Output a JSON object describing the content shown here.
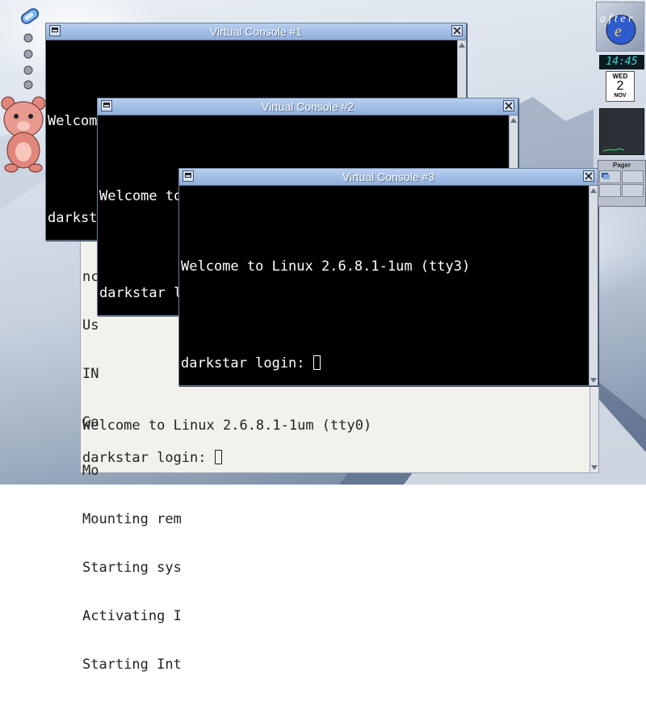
{
  "desktop": {
    "icon": "paperclip-icon",
    "dock_icons": [
      "pin-icon",
      "pin-icon",
      "pin-icon",
      "pin-icon"
    ],
    "mascot": "teddy-bear-icon"
  },
  "dock": {
    "logo": "afterstep-logo",
    "clock_time": "14:45",
    "calendar": {
      "day": "WED",
      "date": "2",
      "month": "NOV"
    },
    "pager_title": "Pager"
  },
  "windows": [
    {
      "title": "Virtual Console #1",
      "welcome": "Welcome to Linux 2.6.8.1-1um (tty1)",
      "login": "darkst"
    },
    {
      "title": "Virtual Console #2",
      "welcome": "Welcome to Linux 2.6.8.1-1um (tty2)",
      "login": "darkstar l"
    },
    {
      "title": "Virtual Console #3",
      "welcome": "Welcome to Linux 2.6.8.1-1um (tty3)",
      "login": "darkstar login: "
    }
  ],
  "tty0": {
    "boot_lines": [
      "nc",
      "Us",
      "IN",
      "Go",
      "Mo",
      "Mounting rem",
      "Starting sys",
      "Activating I",
      "Starting Int"
    ],
    "welcome": "Welcome to Linux 2.6.8.1-1um (tty0)",
    "login": "darkstar login: "
  },
  "colors": {
    "titlebar": "#9fbde6",
    "terminal_bg": "#000000",
    "terminal_fg": "#ffffff"
  }
}
